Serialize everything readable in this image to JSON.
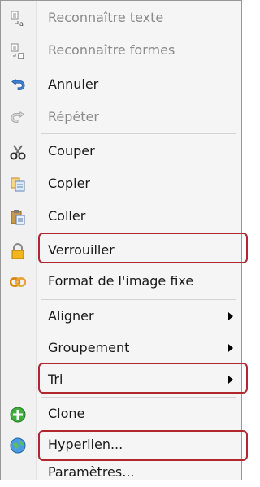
{
  "menu": {
    "items": [
      {
        "label": "Reconnaître texte",
        "icon": "recognize-text-icon"
      },
      {
        "label": "Reconnaître formes",
        "icon": "recognize-shapes-icon"
      },
      {
        "label": "Annuler",
        "icon": "undo-icon"
      },
      {
        "label": "Répéter",
        "icon": "redo-icon"
      },
      {
        "label": "Couper",
        "icon": "scissors-icon"
      },
      {
        "label": "Copier",
        "icon": "copy-icon"
      },
      {
        "label": "Coller",
        "icon": "paste-icon"
      },
      {
        "label": "Verrouiller",
        "icon": "lock-icon"
      },
      {
        "label": "Format de l'image fixe",
        "icon": "link-chain-icon"
      },
      {
        "label": "Aligner"
      },
      {
        "label": "Groupement"
      },
      {
        "label": "Tri"
      },
      {
        "label": "Clone",
        "icon": "clone-plus-icon"
      },
      {
        "label": "Hyperlien...",
        "icon": "globe-icon"
      },
      {
        "label": "Paramètres..."
      }
    ]
  }
}
